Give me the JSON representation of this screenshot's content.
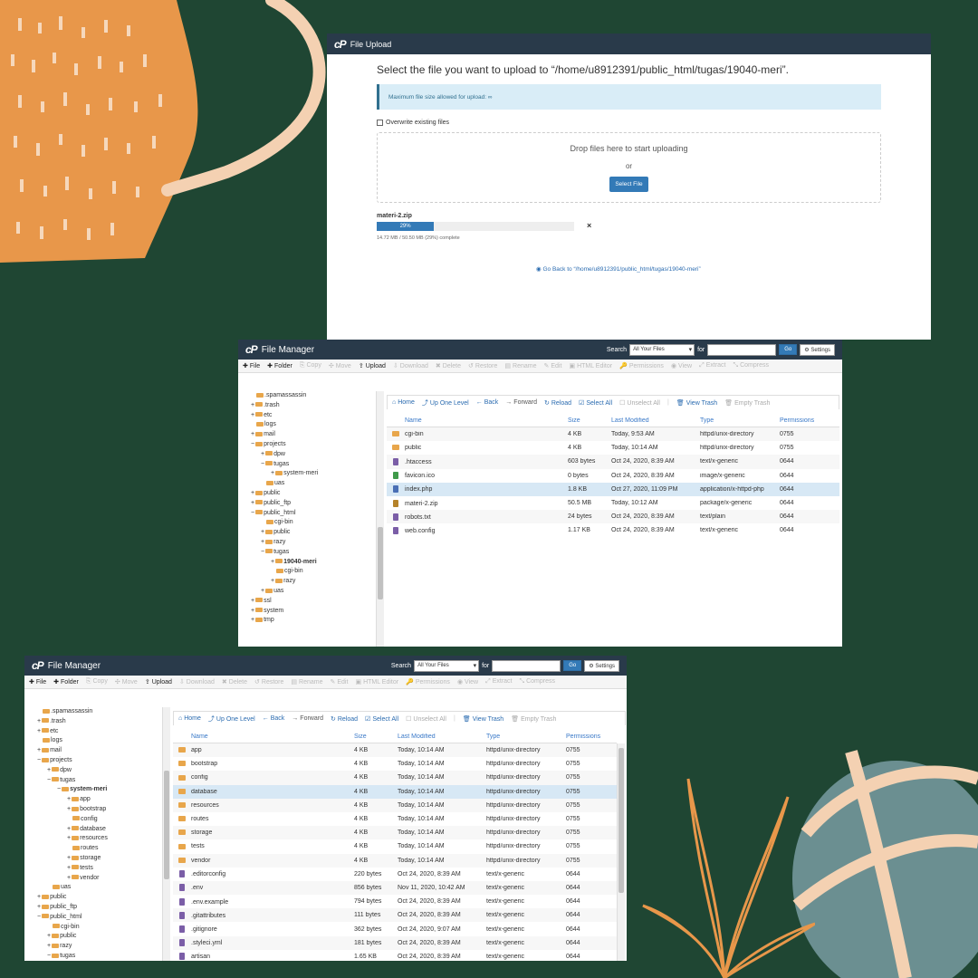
{
  "upload": {
    "title": "File Upload",
    "heading": "Select the file you want to upload to “/home/u8912391/public_html/tugas/19040-meri”.",
    "max_size": "Maximum file size allowed for upload: ∞",
    "overwrite": "Overwrite existing files",
    "drop_text": "Drop files here to start uploading",
    "or": "or",
    "select_btn": "Select File",
    "file_name": "materi-2.zip",
    "progress_label": "29%",
    "progress": 0.29,
    "progress_detail": "14.72 MB / 50.50 MB (29%) complete",
    "close": "×",
    "back_link": "Go Back to “/home/u8912391/public_html/tugas/19040-meri”"
  },
  "fm": {
    "title": "File Manager",
    "search_label": "Search",
    "search_scope": "All Your Files",
    "for_label": "for",
    "go": "Go",
    "settings": "Settings",
    "toolbar": [
      "File",
      "Folder",
      "Copy",
      "Move",
      "Upload",
      "Download",
      "Delete",
      "Restore",
      "Rename",
      "Edit",
      "HTML Editor",
      "Permissions",
      "View",
      "Extract",
      "Compress"
    ],
    "nav": [
      "Home",
      "Up One Level",
      "Back",
      "Forward",
      "Reload",
      "Select All",
      "Unselect All",
      "View Trash",
      "Empty Trash"
    ],
    "columns": [
      "Name",
      "Size",
      "Last Modified",
      "Type",
      "Permissions"
    ]
  },
  "fm1": {
    "tree": [
      ".spamassassin",
      "+ .trash",
      "+ etc",
      "logs",
      "+ mail",
      "− projects",
      "+ dpw",
      "− tugas",
      "+ system-meri",
      "uas",
      "+ public",
      "+ public_ftp",
      "− public_html",
      "cgi-bin",
      "+ public",
      "+ razy",
      "− tugas",
      "+ 19040-meri",
      "cgi-bin",
      "+ razy",
      "+ uas",
      "+ ssl",
      "+ system",
      "+ tmp"
    ],
    "rows": [
      {
        "name": "cgi-bin",
        "size": "4 KB",
        "modified": "Today, 9:53 AM",
        "type": "httpd/unix-directory",
        "perm": "0755",
        "icon": "folder-icon"
      },
      {
        "name": "public",
        "size": "4 KB",
        "modified": "Today, 10:14 AM",
        "type": "httpd/unix-directory",
        "perm": "0755",
        "icon": "folder-icon"
      },
      {
        "name": ".htaccess",
        "size": "603 bytes",
        "modified": "Oct 24, 2020, 8:39 AM",
        "type": "text/x-generic",
        "perm": "0644",
        "icon": "text-file-icon"
      },
      {
        "name": "favicon.ico",
        "size": "0 bytes",
        "modified": "Oct 24, 2020, 8:39 AM",
        "type": "image/x-generic",
        "perm": "0644",
        "icon": "image-file-icon"
      },
      {
        "name": "index.php",
        "size": "1.8 KB",
        "modified": "Oct 27, 2020, 11:09 PM",
        "type": "application/x-httpd-php",
        "perm": "0644",
        "icon": "php-file-icon"
      },
      {
        "name": "materi-2.zip",
        "size": "50.5 MB",
        "modified": "Today, 10:12 AM",
        "type": "package/x-generic",
        "perm": "0644",
        "icon": "zip-file-icon"
      },
      {
        "name": "robots.txt",
        "size": "24 bytes",
        "modified": "Oct 24, 2020, 8:39 AM",
        "type": "text/plain",
        "perm": "0644",
        "icon": "text-file-icon"
      },
      {
        "name": "web.config",
        "size": "1.17 KB",
        "modified": "Oct 24, 2020, 8:39 AM",
        "type": "text/x-generic",
        "perm": "0644",
        "icon": "text-file-icon"
      }
    ]
  },
  "fm2": {
    "tree": [
      ".spamassassin",
      "+ .trash",
      "+ etc",
      "logs",
      "+ mail",
      "− projects",
      "+ dpw",
      "− tugas",
      "− system-meri",
      "+ app",
      "+ bootstrap",
      "config",
      "+ database",
      "+ resources",
      "routes",
      "+ storage",
      "+ tests",
      "+ vendor",
      "uas",
      "+ public",
      "+ public_ftp",
      "− public_html",
      "cgi-bin",
      "+ public",
      "+ razy",
      "− tugas"
    ],
    "rows": [
      {
        "name": "app",
        "size": "4 KB",
        "modified": "Today, 10:14 AM",
        "type": "httpd/unix-directory",
        "perm": "0755",
        "icon": "folder-icon"
      },
      {
        "name": "bootstrap",
        "size": "4 KB",
        "modified": "Today, 10:14 AM",
        "type": "httpd/unix-directory",
        "perm": "0755",
        "icon": "folder-icon"
      },
      {
        "name": "config",
        "size": "4 KB",
        "modified": "Today, 10:14 AM",
        "type": "httpd/unix-directory",
        "perm": "0755",
        "icon": "folder-icon"
      },
      {
        "name": "database",
        "size": "4 KB",
        "modified": "Today, 10:14 AM",
        "type": "httpd/unix-directory",
        "perm": "0755",
        "icon": "folder-icon"
      },
      {
        "name": "resources",
        "size": "4 KB",
        "modified": "Today, 10:14 AM",
        "type": "httpd/unix-directory",
        "perm": "0755",
        "icon": "folder-icon"
      },
      {
        "name": "routes",
        "size": "4 KB",
        "modified": "Today, 10:14 AM",
        "type": "httpd/unix-directory",
        "perm": "0755",
        "icon": "folder-icon"
      },
      {
        "name": "storage",
        "size": "4 KB",
        "modified": "Today, 10:14 AM",
        "type": "httpd/unix-directory",
        "perm": "0755",
        "icon": "folder-icon"
      },
      {
        "name": "tests",
        "size": "4 KB",
        "modified": "Today, 10:14 AM",
        "type": "httpd/unix-directory",
        "perm": "0755",
        "icon": "folder-icon"
      },
      {
        "name": "vendor",
        "size": "4 KB",
        "modified": "Today, 10:14 AM",
        "type": "httpd/unix-directory",
        "perm": "0755",
        "icon": "folder-icon"
      },
      {
        "name": ".editorconfig",
        "size": "220 bytes",
        "modified": "Oct 24, 2020, 8:39 AM",
        "type": "text/x-generic",
        "perm": "0644",
        "icon": "text-file-icon"
      },
      {
        "name": ".env",
        "size": "856 bytes",
        "modified": "Nov 11, 2020, 10:42 AM",
        "type": "text/x-generic",
        "perm": "0644",
        "icon": "text-file-icon"
      },
      {
        "name": ".env.example",
        "size": "794 bytes",
        "modified": "Oct 24, 2020, 8:39 AM",
        "type": "text/x-generic",
        "perm": "0644",
        "icon": "text-file-icon"
      },
      {
        "name": ".gitattributes",
        "size": "111 bytes",
        "modified": "Oct 24, 2020, 8:39 AM",
        "type": "text/x-generic",
        "perm": "0644",
        "icon": "text-file-icon"
      },
      {
        "name": ".gitignore",
        "size": "362 bytes",
        "modified": "Oct 24, 2020, 9:07 AM",
        "type": "text/x-generic",
        "perm": "0644",
        "icon": "text-file-icon"
      },
      {
        "name": ".styleci.yml",
        "size": "181 bytes",
        "modified": "Oct 24, 2020, 8:39 AM",
        "type": "text/x-generic",
        "perm": "0644",
        "icon": "text-file-icon"
      },
      {
        "name": "artisan",
        "size": "1.65 KB",
        "modified": "Oct 24, 2020, 8:39 AM",
        "type": "text/x-generic",
        "perm": "0644",
        "icon": "text-file-icon"
      }
    ]
  },
  "colors": {
    "background": "#1f4633",
    "orange": "#e8974a",
    "cream": "#f4d1b2",
    "teal": "#6b8f91",
    "header": "#293a4a",
    "link": "#2a6bb0",
    "button": "#337ab7"
  }
}
